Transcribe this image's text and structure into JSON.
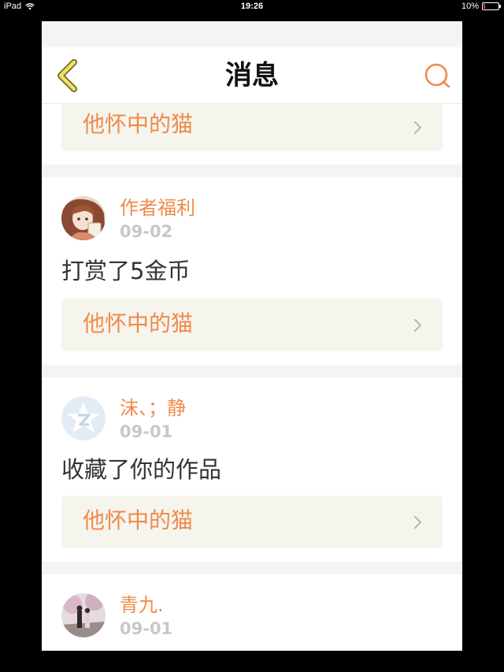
{
  "status_bar": {
    "device": "iPad",
    "time": "19:26",
    "battery_text": "10%",
    "battery_level": 0.1,
    "icons": [
      "wifi-icon",
      "battery-icon"
    ]
  },
  "nav": {
    "title": "消息",
    "back_icon": "chevron-left-icon",
    "search_icon": "search-icon"
  },
  "colors": {
    "accent": "#f08a4b",
    "back_icon": "#f3e263",
    "card_box": "#f5f5ee",
    "date_gray": "#c8c8c8"
  },
  "messages": [
    {
      "user": "",
      "date": "",
      "action": "",
      "work_title": "他怀中的猫",
      "partial": true
    },
    {
      "user": "作者福利",
      "date": "09-02",
      "action": "打赏了5金币",
      "work_title": "他怀中的猫",
      "avatar": "anime-girl-avatar"
    },
    {
      "user": "沫、；静",
      "date": "09-01",
      "action": "收藏了你的作品",
      "work_title": "他怀中的猫",
      "avatar": "qzone-default-avatar"
    },
    {
      "user": "青九.",
      "date": "09-01",
      "action": "",
      "work_title": "",
      "avatar": "photo-avatar"
    }
  ]
}
